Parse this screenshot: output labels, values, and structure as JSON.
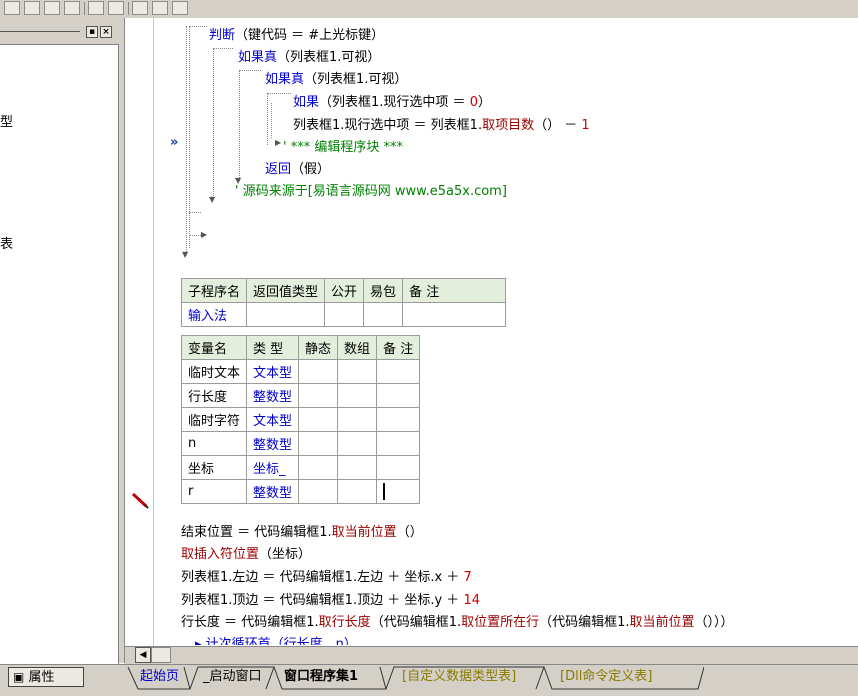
{
  "left_panel": {
    "fragments": [
      "型",
      "表"
    ],
    "properties_label": "属性"
  },
  "code": {
    "line1_kw": "判断",
    "line1_rest": "（键代码 ＝ #上光标键）",
    "line2_kw": "如果真",
    "line2_rest": "（列表框1.可视）",
    "line3_kw": "如果真",
    "line3_rest": "（列表框1.可视）",
    "line4_kw": "如果",
    "line4_a": "（列表框1.现行选中项 ＝ ",
    "line4_num": "0",
    "line4_b": "）",
    "line5_a": "列表框1.现行选中项 ＝ 列表框1.",
    "line5_mth": "取项目数",
    "line5_b": "（） － ",
    "line5_num": "1",
    "line6": "' *** 编辑程序块 ***",
    "line7_kw": "返回",
    "line7_rest": "（假）",
    "line8": "' 源码来源于[易语言源码网 www.e5a5x.com]",
    "arrow": "»"
  },
  "sub_table": {
    "headers": [
      "子程序名",
      "返回值类型",
      "公开",
      "易包",
      "备 注"
    ],
    "row": [
      "输入法",
      "",
      "",
      "",
      ""
    ]
  },
  "var_table": {
    "headers": [
      "变量名",
      "类 型",
      "静态",
      "数组",
      "备 注"
    ],
    "rows": [
      [
        "临时文本",
        "文本型",
        "",
        "",
        ""
      ],
      [
        "行长度",
        "整数型",
        "",
        "",
        ""
      ],
      [
        "临时字符",
        "文本型",
        "",
        "",
        ""
      ],
      [
        "n",
        "整数型",
        "",
        "",
        ""
      ],
      [
        "坐标",
        "坐标_",
        "",
        "",
        ""
      ],
      [
        "r",
        "整数型",
        "",
        "",
        ""
      ]
    ]
  },
  "code2": {
    "l1_a": "结束位置 ＝ 代码编辑框1.",
    "l1_mth": "取当前位置",
    "l1_b": "（）",
    "l2_mth": "取插入符位置",
    "l2_b": "（坐标）",
    "l3_a": "列表框1.左边 ＝ 代码编辑框1.左边 ＋ 坐标.x ＋ ",
    "l3_num": "7",
    "l4_a": "列表框1.顶边 ＝ 代码编辑框1.顶边 ＋ 坐标.y ＋ ",
    "l4_num": "14",
    "l5_a": "行长度 ＝ 代码编辑框1.",
    "l5_m1": "取行长度",
    "l5_b": "（代码编辑框1.",
    "l5_m2": "取位置所在行",
    "l5_c": "（代码编辑框1.",
    "l5_m3": "取当前位置",
    "l5_d": "（）））",
    "l6": "▸ 计次循环首（行长度，n）"
  },
  "tabs": [
    "起始页",
    "_启动窗口",
    "窗口程序集1",
    "[自定义数据类型表]",
    "[Dll命令定义表]"
  ],
  "colors": {
    "keyword": "#0000cc",
    "method": "#990000",
    "number": "#cc0000",
    "comment": "#008000"
  }
}
